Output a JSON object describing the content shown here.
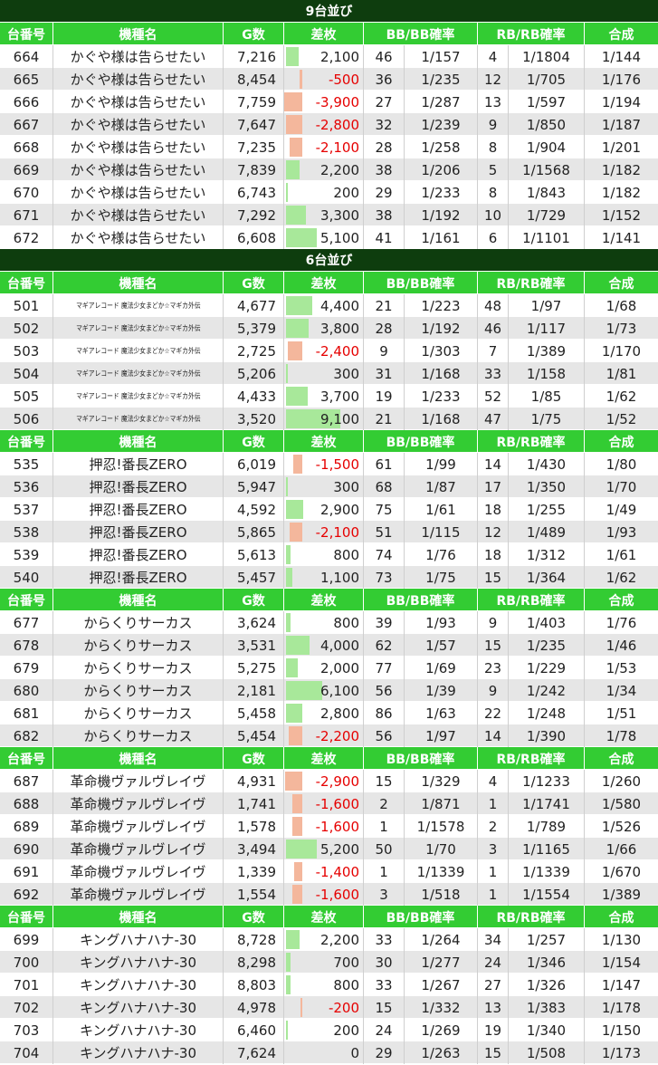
{
  "headers": [
    "台番号",
    "機種名",
    "G数",
    "差枚",
    "BB/BB確率",
    "RB/RB確率",
    "合成"
  ],
  "sections": [
    {
      "title": "9台並び",
      "show_header": true,
      "rows": [
        {
          "no": "664",
          "name": "かぐや様は告らせたい",
          "g": "7,216",
          "diff": "2,100",
          "diff_value": 2100,
          "bb": "46",
          "bbp": "1/157",
          "rb": "4",
          "rbp": "1/1804",
          "total": "1/144"
        },
        {
          "no": "665",
          "name": "かぐや様は告らせたい",
          "g": "8,454",
          "diff": "-500",
          "diff_value": -500,
          "bb": "36",
          "bbp": "1/235",
          "rb": "12",
          "rbp": "1/705",
          "total": "1/176"
        },
        {
          "no": "666",
          "name": "かぐや様は告らせたい",
          "g": "7,759",
          "diff": "-3,900",
          "diff_value": -3900,
          "bb": "27",
          "bbp": "1/287",
          "rb": "13",
          "rbp": "1/597",
          "total": "1/194"
        },
        {
          "no": "667",
          "name": "かぐや様は告らせたい",
          "g": "7,647",
          "diff": "-2,800",
          "diff_value": -2800,
          "bb": "32",
          "bbp": "1/239",
          "rb": "9",
          "rbp": "1/850",
          "total": "1/187"
        },
        {
          "no": "668",
          "name": "かぐや様は告らせたい",
          "g": "7,235",
          "diff": "-2,100",
          "diff_value": -2100,
          "bb": "28",
          "bbp": "1/258",
          "rb": "8",
          "rbp": "1/904",
          "total": "1/201"
        },
        {
          "no": "669",
          "name": "かぐや様は告らせたい",
          "g": "7,839",
          "diff": "2,200",
          "diff_value": 2200,
          "bb": "38",
          "bbp": "1/206",
          "rb": "5",
          "rbp": "1/1568",
          "total": "1/182"
        },
        {
          "no": "670",
          "name": "かぐや様は告らせたい",
          "g": "6,743",
          "diff": "200",
          "diff_value": 200,
          "bb": "29",
          "bbp": "1/233",
          "rb": "8",
          "rbp": "1/843",
          "total": "1/182"
        },
        {
          "no": "671",
          "name": "かぐや様は告らせたい",
          "g": "7,292",
          "diff": "3,300",
          "diff_value": 3300,
          "bb": "38",
          "bbp": "1/192",
          "rb": "10",
          "rbp": "1/729",
          "total": "1/152"
        },
        {
          "no": "672",
          "name": "かぐや様は告らせたい",
          "g": "6,608",
          "diff": "5,100",
          "diff_value": 5100,
          "bb": "41",
          "bbp": "1/161",
          "rb": "6",
          "rbp": "1/1101",
          "total": "1/141"
        }
      ]
    },
    {
      "title": "6台並び",
      "show_header": true,
      "rows": [
        {
          "no": "501",
          "name": "マギアレコード 魔法少女まどか☆マギカ外伝",
          "small": true,
          "g": "4,677",
          "diff": "4,400",
          "diff_value": 4400,
          "bb": "21",
          "bbp": "1/223",
          "rb": "48",
          "rbp": "1/97",
          "total": "1/68"
        },
        {
          "no": "502",
          "name": "マギアレコード 魔法少女まどか☆マギカ外伝",
          "small": true,
          "g": "5,379",
          "diff": "3,800",
          "diff_value": 3800,
          "bb": "28",
          "bbp": "1/192",
          "rb": "46",
          "rbp": "1/117",
          "total": "1/73"
        },
        {
          "no": "503",
          "name": "マギアレコード 魔法少女まどか☆マギカ外伝",
          "small": true,
          "g": "2,725",
          "diff": "-2,400",
          "diff_value": -2400,
          "bb": "9",
          "bbp": "1/303",
          "rb": "7",
          "rbp": "1/389",
          "total": "1/170"
        },
        {
          "no": "504",
          "name": "マギアレコード 魔法少女まどか☆マギカ外伝",
          "small": true,
          "g": "5,206",
          "diff": "300",
          "diff_value": 300,
          "bb": "31",
          "bbp": "1/168",
          "rb": "33",
          "rbp": "1/158",
          "total": "1/81"
        },
        {
          "no": "505",
          "name": "マギアレコード 魔法少女まどか☆マギカ外伝",
          "small": true,
          "g": "4,433",
          "diff": "3,700",
          "diff_value": 3700,
          "bb": "19",
          "bbp": "1/233",
          "rb": "52",
          "rbp": "1/85",
          "total": "1/62"
        },
        {
          "no": "506",
          "name": "マギアレコード 魔法少女まどか☆マギカ外伝",
          "small": true,
          "g": "3,520",
          "diff": "9,100",
          "diff_value": 9100,
          "bb": "21",
          "bbp": "1/168",
          "rb": "47",
          "rbp": "1/75",
          "total": "1/52"
        }
      ]
    },
    {
      "title": "",
      "show_header": true,
      "rows": [
        {
          "no": "535",
          "name": "押忍!番長ZERO",
          "g": "6,019",
          "diff": "-1,500",
          "diff_value": -1500,
          "bb": "61",
          "bbp": "1/99",
          "rb": "14",
          "rbp": "1/430",
          "total": "1/80"
        },
        {
          "no": "536",
          "name": "押忍!番長ZERO",
          "g": "5,947",
          "diff": "300",
          "diff_value": 300,
          "bb": "68",
          "bbp": "1/87",
          "rb": "17",
          "rbp": "1/350",
          "total": "1/70"
        },
        {
          "no": "537",
          "name": "押忍!番長ZERO",
          "g": "4,592",
          "diff": "2,900",
          "diff_value": 2900,
          "bb": "75",
          "bbp": "1/61",
          "rb": "18",
          "rbp": "1/255",
          "total": "1/49"
        },
        {
          "no": "538",
          "name": "押忍!番長ZERO",
          "g": "5,865",
          "diff": "-2,100",
          "diff_value": -2100,
          "bb": "51",
          "bbp": "1/115",
          "rb": "12",
          "rbp": "1/489",
          "total": "1/93"
        },
        {
          "no": "539",
          "name": "押忍!番長ZERO",
          "g": "5,613",
          "diff": "800",
          "diff_value": 800,
          "bb": "74",
          "bbp": "1/76",
          "rb": "18",
          "rbp": "1/312",
          "total": "1/61"
        },
        {
          "no": "540",
          "name": "押忍!番長ZERO",
          "g": "5,457",
          "diff": "1,100",
          "diff_value": 1100,
          "bb": "73",
          "bbp": "1/75",
          "rb": "15",
          "rbp": "1/364",
          "total": "1/62"
        }
      ]
    },
    {
      "title": "",
      "show_header": true,
      "rows": [
        {
          "no": "677",
          "name": "からくりサーカス",
          "g": "3,624",
          "diff": "800",
          "diff_value": 800,
          "bb": "39",
          "bbp": "1/93",
          "rb": "9",
          "rbp": "1/403",
          "total": "1/76"
        },
        {
          "no": "678",
          "name": "からくりサーカス",
          "g": "3,531",
          "diff": "4,000",
          "diff_value": 4000,
          "bb": "62",
          "bbp": "1/57",
          "rb": "15",
          "rbp": "1/235",
          "total": "1/46"
        },
        {
          "no": "679",
          "name": "からくりサーカス",
          "g": "5,275",
          "diff": "2,000",
          "diff_value": 2000,
          "bb": "77",
          "bbp": "1/69",
          "rb": "23",
          "rbp": "1/229",
          "total": "1/53"
        },
        {
          "no": "680",
          "name": "からくりサーカス",
          "g": "2,181",
          "diff": "6,100",
          "diff_value": 6100,
          "bb": "56",
          "bbp": "1/39",
          "rb": "9",
          "rbp": "1/242",
          "total": "1/34"
        },
        {
          "no": "681",
          "name": "からくりサーカス",
          "g": "5,458",
          "diff": "2,800",
          "diff_value": 2800,
          "bb": "86",
          "bbp": "1/63",
          "rb": "22",
          "rbp": "1/248",
          "total": "1/51"
        },
        {
          "no": "682",
          "name": "からくりサーカス",
          "g": "5,454",
          "diff": "-2,200",
          "diff_value": -2200,
          "bb": "56",
          "bbp": "1/97",
          "rb": "14",
          "rbp": "1/390",
          "total": "1/78"
        }
      ]
    },
    {
      "title": "",
      "show_header": true,
      "rows": [
        {
          "no": "687",
          "name": "革命機ヴァルヴレイヴ",
          "g": "4,931",
          "diff": "-2,900",
          "diff_value": -2900,
          "bb": "15",
          "bbp": "1/329",
          "rb": "4",
          "rbp": "1/1233",
          "total": "1/260"
        },
        {
          "no": "688",
          "name": "革命機ヴァルヴレイヴ",
          "g": "1,741",
          "diff": "-1,600",
          "diff_value": -1600,
          "bb": "2",
          "bbp": "1/871",
          "rb": "1",
          "rbp": "1/1741",
          "total": "1/580"
        },
        {
          "no": "689",
          "name": "革命機ヴァルヴレイヴ",
          "g": "1,578",
          "diff": "-1,600",
          "diff_value": -1600,
          "bb": "1",
          "bbp": "1/1578",
          "rb": "2",
          "rbp": "1/789",
          "total": "1/526"
        },
        {
          "no": "690",
          "name": "革命機ヴァルヴレイヴ",
          "g": "3,494",
          "diff": "5,200",
          "diff_value": 5200,
          "bb": "50",
          "bbp": "1/70",
          "rb": "3",
          "rbp": "1/1165",
          "total": "1/66"
        },
        {
          "no": "691",
          "name": "革命機ヴァルヴレイヴ",
          "g": "1,339",
          "diff": "-1,400",
          "diff_value": -1400,
          "bb": "1",
          "bbp": "1/1339",
          "rb": "1",
          "rbp": "1/1339",
          "total": "1/670"
        },
        {
          "no": "692",
          "name": "革命機ヴァルヴレイヴ",
          "g": "1,554",
          "diff": "-1,600",
          "diff_value": -1600,
          "bb": "3",
          "bbp": "1/518",
          "rb": "1",
          "rbp": "1/1554",
          "total": "1/389"
        }
      ]
    },
    {
      "title": "",
      "show_header": true,
      "rows": [
        {
          "no": "699",
          "name": "キングハナハナ-30",
          "g": "8,728",
          "diff": "2,200",
          "diff_value": 2200,
          "bb": "33",
          "bbp": "1/264",
          "rb": "34",
          "rbp": "1/257",
          "total": "1/130"
        },
        {
          "no": "700",
          "name": "キングハナハナ-30",
          "g": "8,298",
          "diff": "700",
          "diff_value": 700,
          "bb": "30",
          "bbp": "1/277",
          "rb": "24",
          "rbp": "1/346",
          "total": "1/154"
        },
        {
          "no": "701",
          "name": "キングハナハナ-30",
          "g": "8,803",
          "diff": "800",
          "diff_value": 800,
          "bb": "33",
          "bbp": "1/267",
          "rb": "27",
          "rbp": "1/326",
          "total": "1/147"
        },
        {
          "no": "702",
          "name": "キングハナハナ-30",
          "g": "4,978",
          "diff": "-200",
          "diff_value": -200,
          "bb": "15",
          "bbp": "1/332",
          "rb": "13",
          "rbp": "1/383",
          "total": "1/178"
        },
        {
          "no": "703",
          "name": "キングハナハナ-30",
          "g": "6,460",
          "diff": "200",
          "diff_value": 200,
          "bb": "24",
          "bbp": "1/269",
          "rb": "19",
          "rbp": "1/340",
          "total": "1/150"
        },
        {
          "no": "704",
          "name": "キングハナハナ-30",
          "g": "7,624",
          "diff": "0",
          "diff_value": 0,
          "bb": "29",
          "bbp": "1/263",
          "rb": "15",
          "rbp": "1/508",
          "total": "1/173"
        }
      ]
    }
  ],
  "colors": {
    "title_bg": "#0e3d0e",
    "header_bg": "#33cc33",
    "positive_bar": "#a8e89a",
    "negative_bar": "#f4b79c",
    "negative_text": "#e60000"
  }
}
